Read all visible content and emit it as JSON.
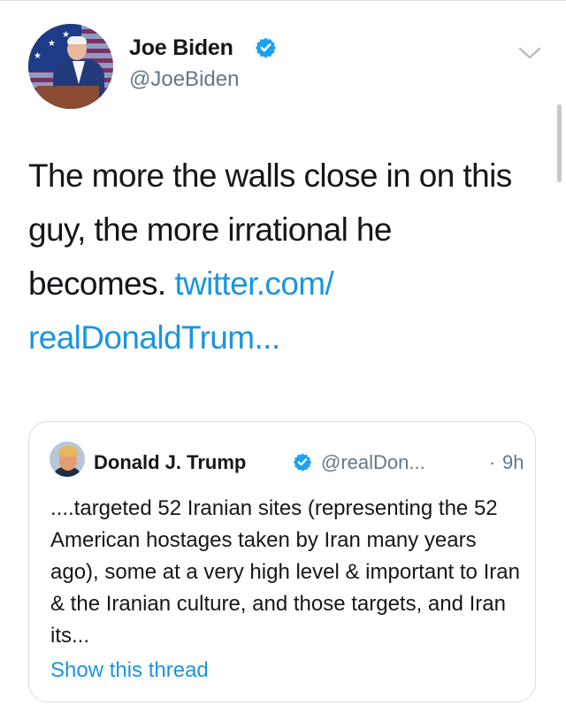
{
  "tweet": {
    "author_name": "Joe Biden",
    "author_handle": "@JoeBiden",
    "verified": true,
    "body_text": "The more the walls close in on this guy, the more irrational he becomes.",
    "link_text": "twitter.com/ realDonaldTrum..."
  },
  "quote": {
    "author_name": "Donald J. Trump",
    "author_handle": "@realDon...",
    "separator": "·",
    "timestamp": "9h",
    "verified": true,
    "text": "....targeted 52 Iranian sites (representing the 52 American hostages taken by Iran many years ago), some at a very high level & important to Iran &  the Iranian culture, and those targets, and Iran its...",
    "show_thread": "Show this thread"
  },
  "icons": {
    "verified": "verified-badge-icon",
    "menu": "chevron-down-icon"
  },
  "colors": {
    "link": "#1b95e0",
    "secondary_text": "#657786",
    "border": "#d8dde2",
    "text": "#14171a"
  }
}
